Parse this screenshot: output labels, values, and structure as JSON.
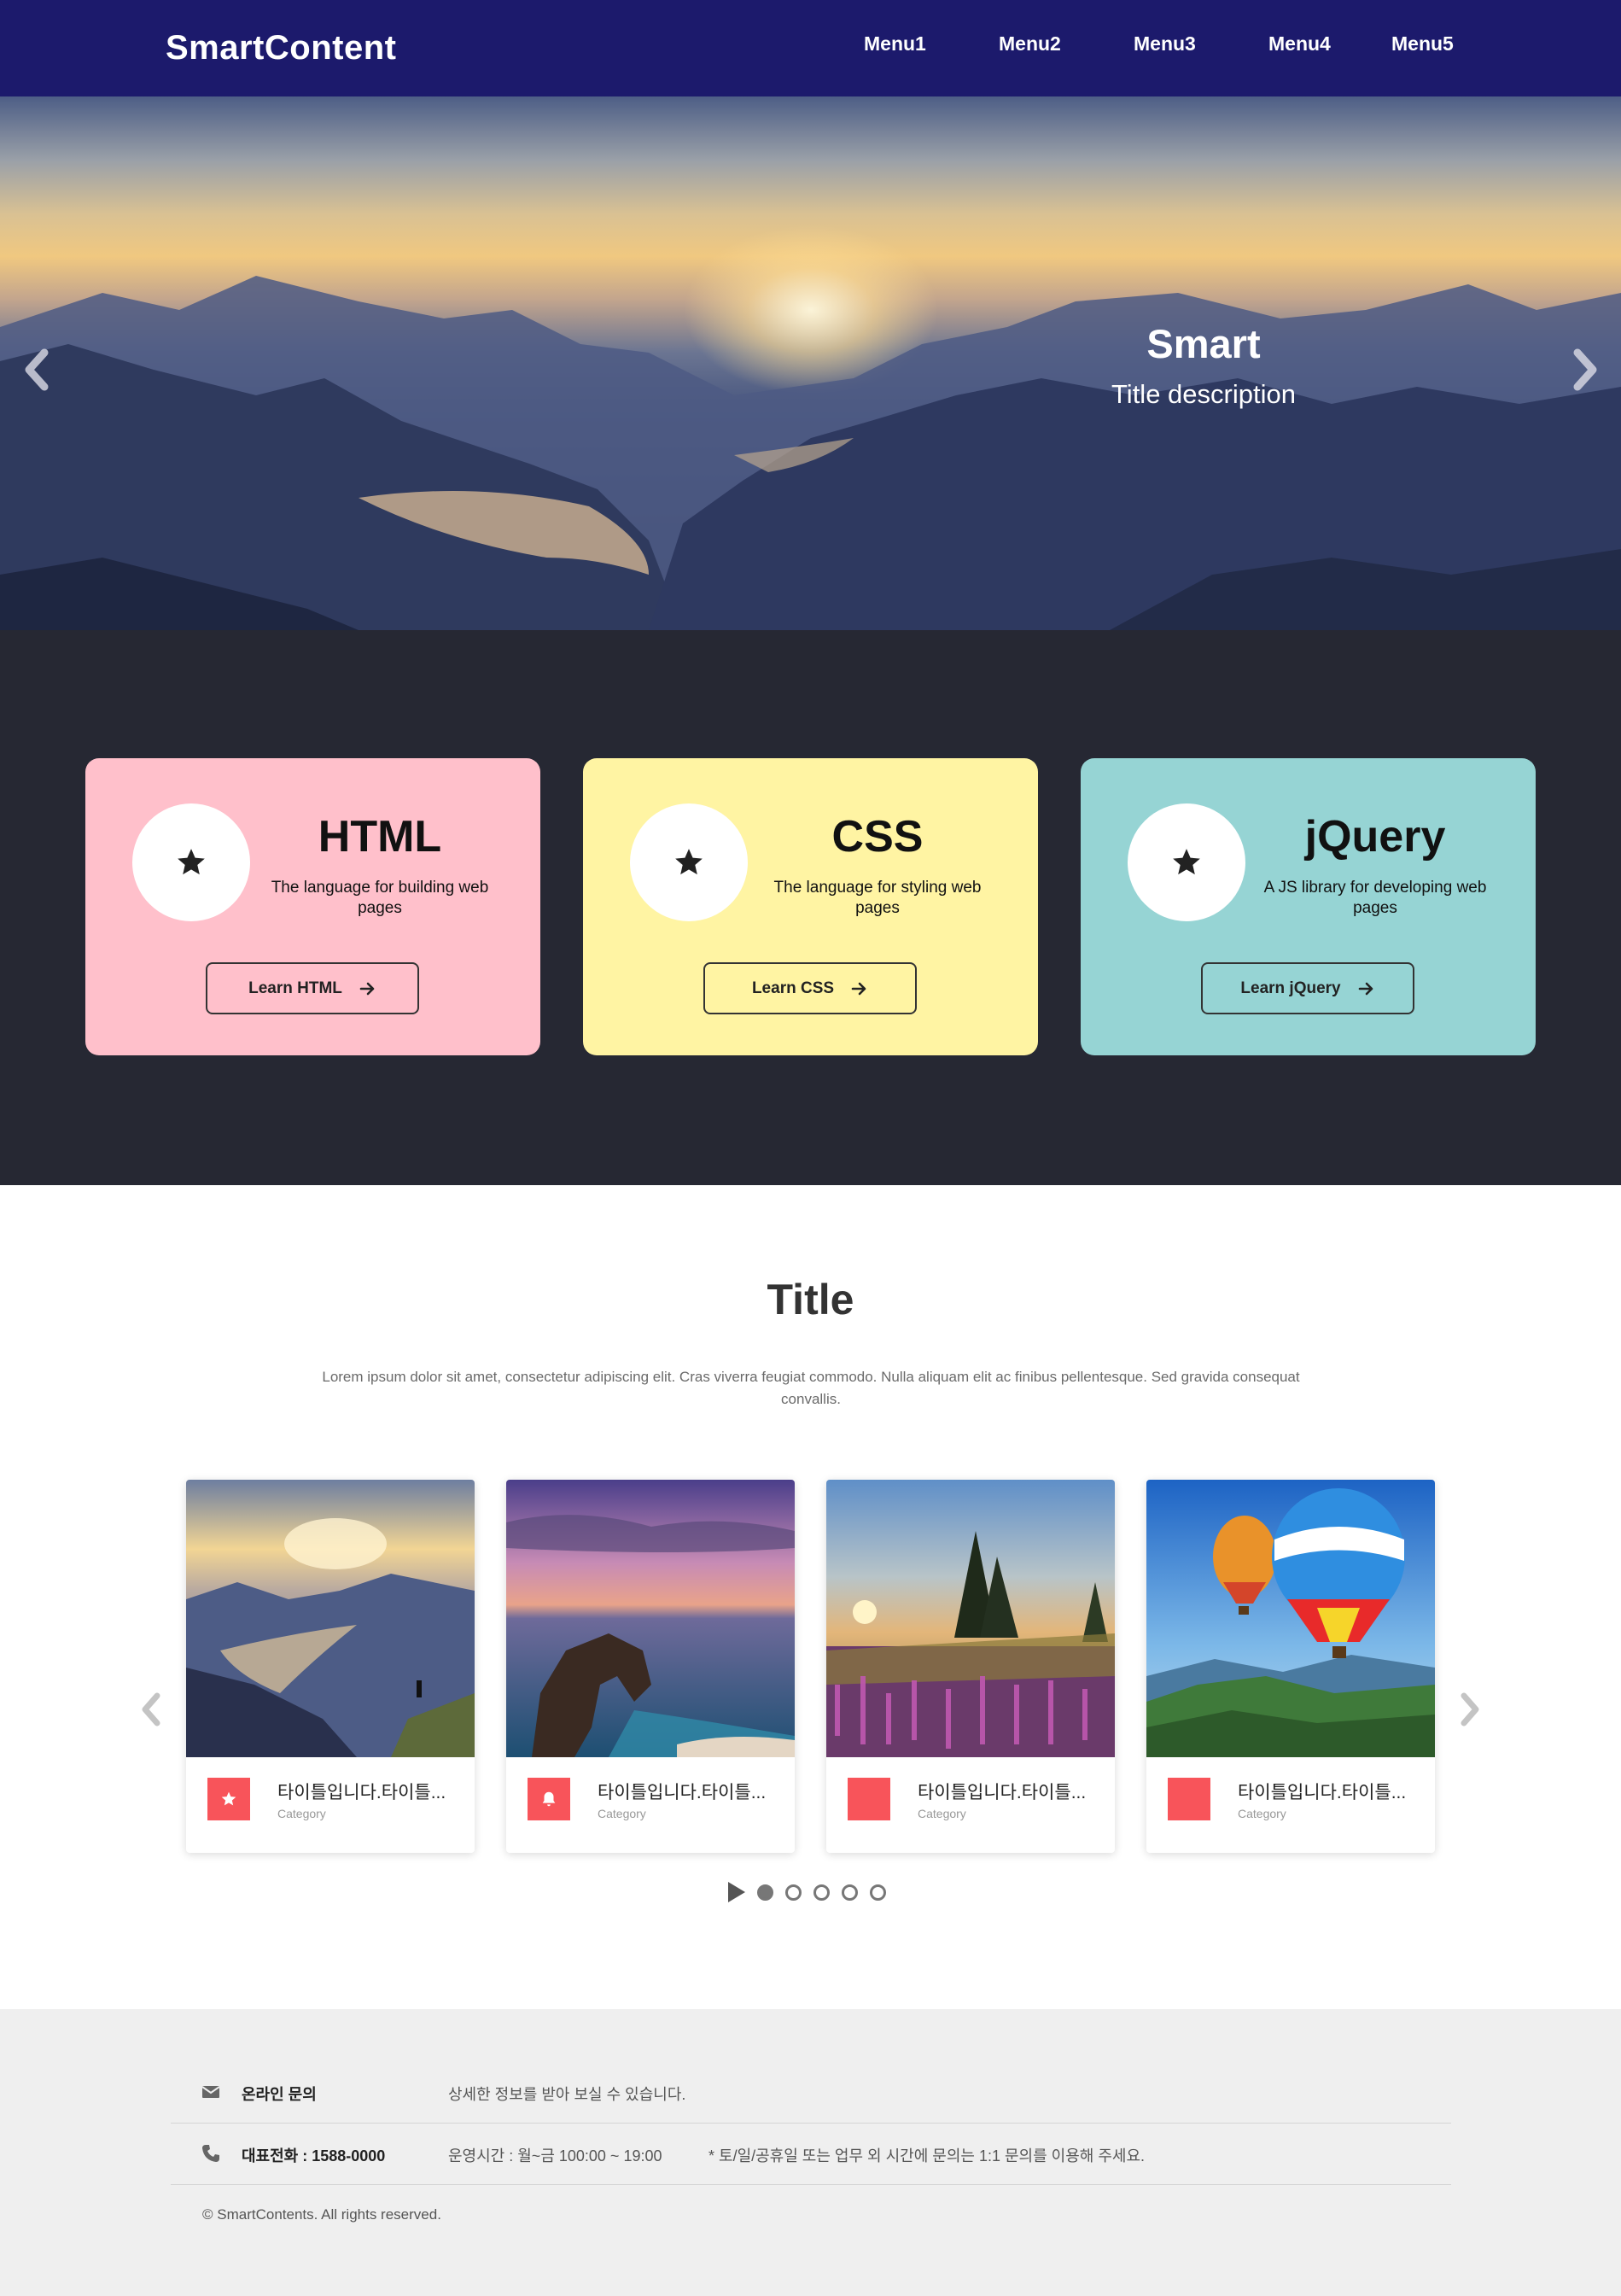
{
  "header": {
    "logo": "SmartContent",
    "menu": [
      "Menu1",
      "Menu2",
      "Menu3",
      "Menu4",
      "Menu5"
    ]
  },
  "hero": {
    "title": "Smart",
    "description": "Title description",
    "slide_count": 3,
    "active_slide": 1
  },
  "cards": [
    {
      "title": "HTML",
      "description": "The language for building web pages",
      "button": "Learn HTML",
      "color": "#ffc0cb",
      "icon": "star-icon"
    },
    {
      "title": "CSS",
      "description": "The language for styling web pages",
      "button": "Learn CSS",
      "color": "#fff4a3",
      "icon": "star-icon"
    },
    {
      "title": "jQuery",
      "description": "A JS library for developing web pages",
      "button": "Learn jQuery",
      "color": "#96d4d4",
      "icon": "star-icon"
    }
  ],
  "section": {
    "title": "Title",
    "description": "Lorem ipsum dolor sit amet, consectetur adipiscing elit. Cras viverra feugiat commodo. Nulla aliquam elit ac finibus pellentesque. Sed gravida consequat convallis."
  },
  "gallery": {
    "items": [
      {
        "title": "타이틀입니다.타이틀...",
        "category": "Category",
        "icon": "star-icon",
        "image": "mountain-lake-sunset"
      },
      {
        "title": "타이틀입니다.타이틀...",
        "category": "Category",
        "icon": "bell-icon",
        "image": "sea-arch-dusk"
      },
      {
        "title": "타이틀입니다.타이틀...",
        "category": "Category",
        "icon": "",
        "image": "flower-field-sunrise"
      },
      {
        "title": "타이틀입니다.타이틀...",
        "category": "Category",
        "icon": "",
        "image": "hot-air-balloons"
      }
    ],
    "page_count": 5,
    "active_page": 1
  },
  "footer": {
    "inquiry_label": "온라인 문의",
    "inquiry_text": "상세한 정보를 받아 보실 수 있습니다.",
    "phone_label": "대표전화 : 1588-0000",
    "hours_text": "운영시간 : 월~금 100:00 ~ 19:00",
    "hours_note": "* 토/일/공휴일 또는 업무 외 시간에 문의는 1:1 문의를 이용해 주세요.",
    "copyright": "© SmartContents. All rights reserved."
  },
  "colors": {
    "header_bg": "#1c1a6c",
    "dark_section_bg": "#262833",
    "badge_red": "#f8545a",
    "footer_bg": "#efefef"
  }
}
